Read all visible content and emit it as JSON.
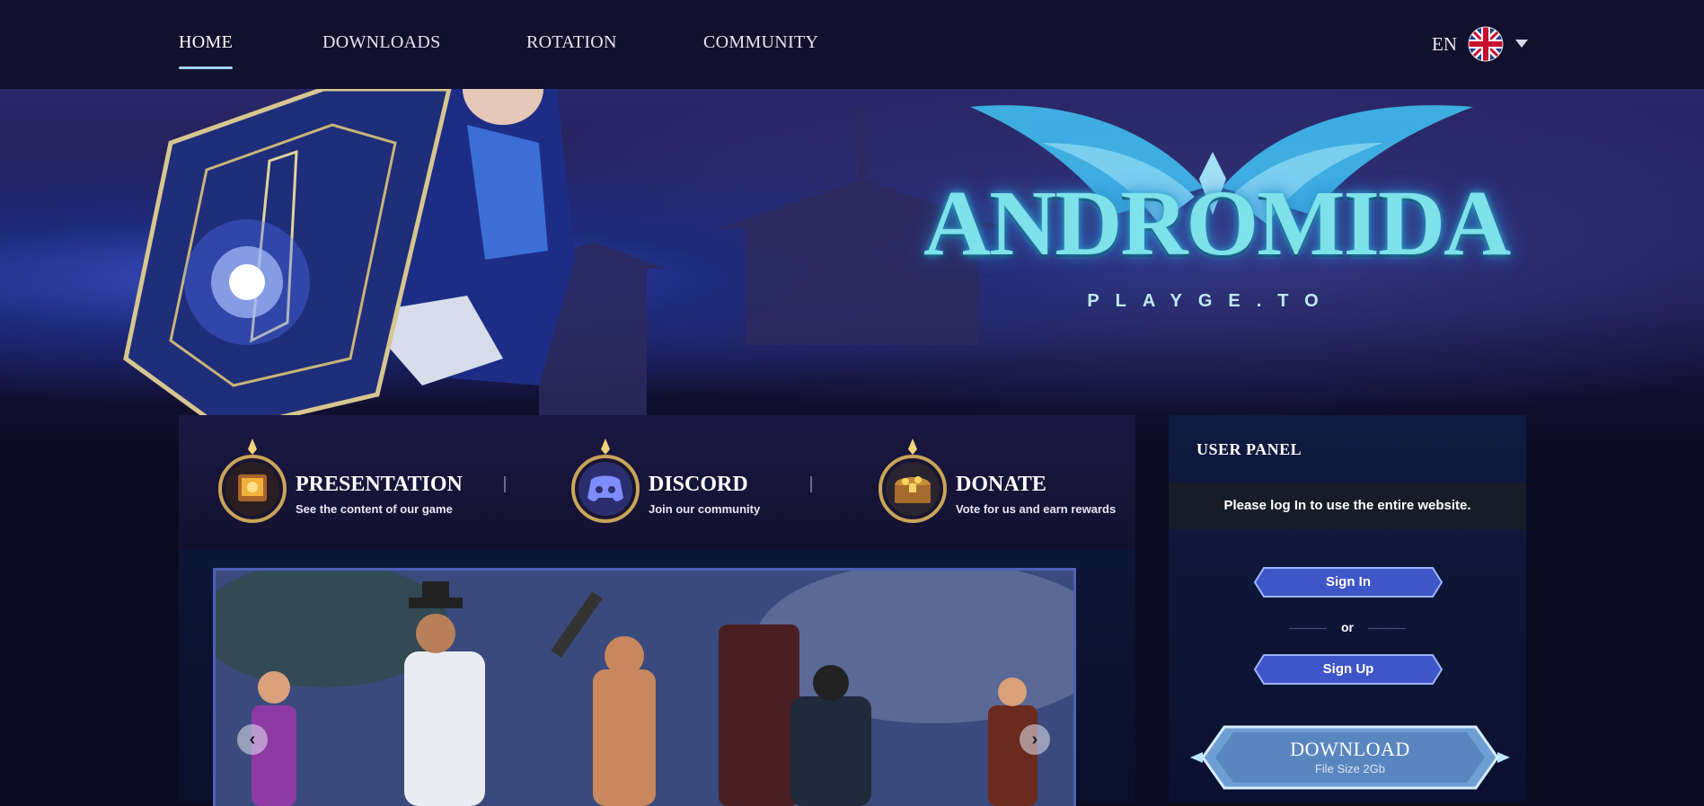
{
  "nav": {
    "items": [
      {
        "label": "HOME",
        "active": true
      },
      {
        "label": "DOWNLOADS",
        "active": false
      },
      {
        "label": "ROTATION",
        "active": false
      },
      {
        "label": "COMMUNITY",
        "active": false
      }
    ],
    "language": "EN",
    "flag_icon": "uk-flag-icon"
  },
  "hero": {
    "logo_title": "ANDROMIDA",
    "logo_subtitle": "PLAYGE.TO"
  },
  "features": [
    {
      "title": "PRESENTATION",
      "subtitle": "See the content of our game",
      "icon": "treasure-book-icon"
    },
    {
      "title": "DISCORD",
      "subtitle": "Join our community",
      "icon": "discord-icon"
    },
    {
      "title": "DONATE",
      "subtitle": "Vote for us and earn rewards",
      "icon": "treasure-chest-icon"
    }
  ],
  "slider": {
    "prev_icon": "chevron-left-icon",
    "next_icon": "chevron-right-icon",
    "prev_glyph": "‹",
    "next_glyph": "›"
  },
  "user_panel": {
    "title": "USER PANEL",
    "message": "Please log In to use the entire website.",
    "sign_in": "Sign In",
    "or": "or",
    "sign_up": "Sign Up",
    "download_title": "DOWNLOAD",
    "download_subtitle": "File Size 2Gb"
  },
  "colors": {
    "nav_bg": "#13102d",
    "accent_underline": "#9fd2f0",
    "button_blue": "#3f56c8",
    "logo_cyan": "#7fe1ea"
  }
}
